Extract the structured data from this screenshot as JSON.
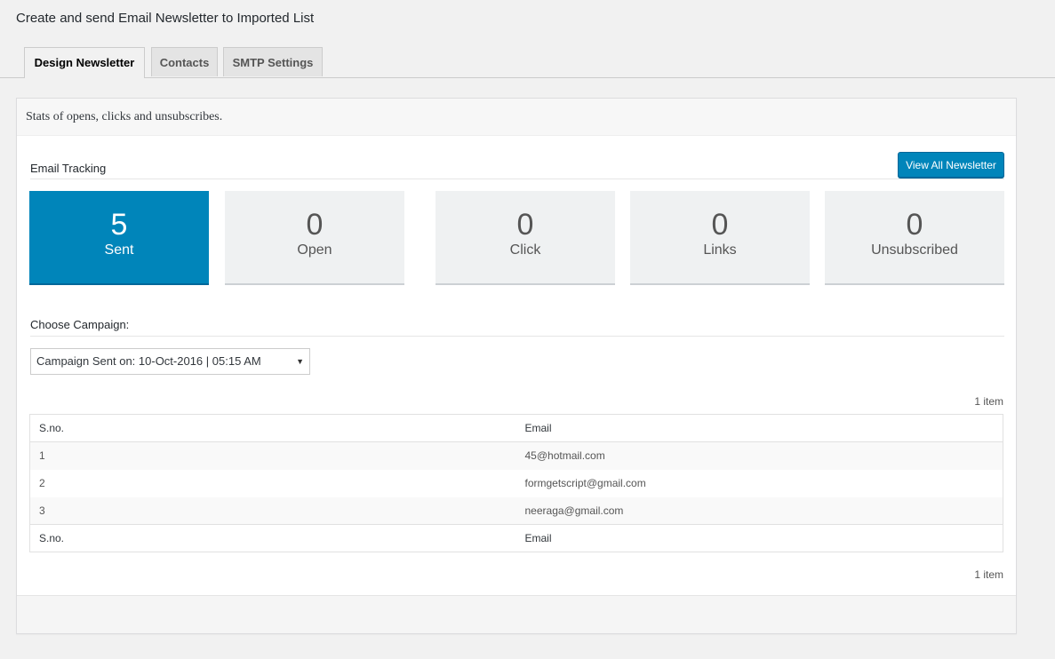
{
  "page_title": "Create and send Email Newsletter to Imported List",
  "tabs": [
    {
      "label": "Design Newsletter",
      "active": true
    },
    {
      "label": "Contacts",
      "active": false
    },
    {
      "label": "SMTP Settings",
      "active": false
    }
  ],
  "panel": {
    "header": "Stats of opens, clicks and unsubscribes.",
    "email_tracking_label": "Email Tracking",
    "view_all_label": "View All Newsletter"
  },
  "stats": [
    {
      "value": "5",
      "label": "Sent"
    },
    {
      "value": "0",
      "label": "Open"
    },
    {
      "value": "0",
      "label": "Click"
    },
    {
      "value": "0",
      "label": "Links"
    },
    {
      "value": "0",
      "label": "Unsubscribed"
    }
  ],
  "campaign": {
    "label": "Choose Campaign:",
    "selected": "Campaign Sent on: 10-Oct-2016 | 05:15 AM"
  },
  "table": {
    "count_top": "1 item",
    "count_bottom": "1 item",
    "columns": [
      "S.no.",
      "Email"
    ],
    "rows": [
      {
        "sno": "1",
        "email": "45@hotmail.com"
      },
      {
        "sno": "2",
        "email": "formgetscript@gmail.com"
      },
      {
        "sno": "3",
        "email": "neeraga@gmail.com"
      }
    ]
  },
  "colors": {
    "accent": "#0085ba",
    "tile": "#eff1f2",
    "background": "#f1f1f1"
  },
  "icons": {
    "select_arrow": "caret-down-icon"
  }
}
